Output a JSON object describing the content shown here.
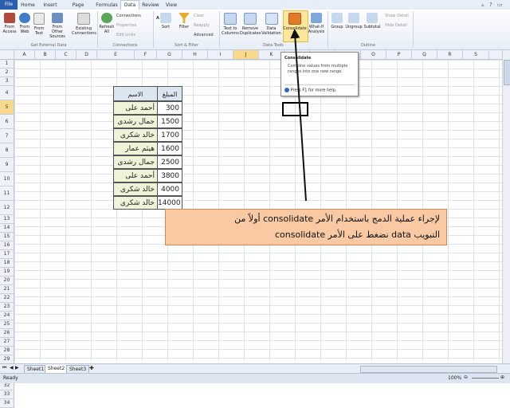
{
  "tabs": [
    "File",
    "Home",
    "Insert",
    "Page Layout",
    "Formulas",
    "Data",
    "Review",
    "View"
  ],
  "active_tab": "Data",
  "ribbon": {
    "get_external": {
      "from_access": "From Access",
      "from_web": "From Web",
      "from_text": "From Text",
      "from_other": "From Other Sources",
      "existing": "Existing Connections",
      "label": "Get External Data"
    },
    "connections": {
      "refresh": "Refresh All",
      "connections": "Connections",
      "properties": "Properties",
      "edit_links": "Edit Links",
      "label": "Connections"
    },
    "sort_filter": {
      "sort_az": "A↓Z",
      "sort": "Sort",
      "filter": "Filter",
      "clear": "Clear",
      "reapply": "Reapply",
      "advanced": "Advanced",
      "label": "Sort & Filter"
    },
    "data_tools": {
      "text_to_columns": "Text to Columns",
      "remove_dup": "Remove Duplicates",
      "validation": "Data Validation",
      "consolidate": "Consolidate",
      "whatif": "What-If Analysis",
      "label": "Data Tools"
    },
    "outline": {
      "group": "Group",
      "ungroup": "Ungroup",
      "subtotal": "Subtotal",
      "show_detail": "Show Detail",
      "hide_detail": "Hide Detail",
      "label": "Outline"
    }
  },
  "columns": [
    "A",
    "B",
    "C",
    "D",
    "E",
    "F",
    "G",
    "H",
    "I",
    "J",
    "K",
    "L",
    "M",
    "N",
    "O",
    "P",
    "Q",
    "R",
    "S"
  ],
  "rows": [
    "1",
    "2",
    "3",
    "4",
    "5",
    "6",
    "7",
    "8",
    "9",
    "10",
    "11",
    "12",
    "13",
    "14",
    "15",
    "16",
    "17",
    "18",
    "19",
    "20",
    "21",
    "22",
    "23",
    "24",
    "25",
    "26",
    "27",
    "28",
    "29",
    "30",
    "31",
    "32",
    "33",
    "34"
  ],
  "table": {
    "header_name": "الاسم",
    "header_amount": "المبلغ",
    "rows": [
      {
        "name": "أحمد على",
        "amount": "300"
      },
      {
        "name": "جمال رشدى",
        "amount": "1500"
      },
      {
        "name": "خالد شكرى",
        "amount": "1700"
      },
      {
        "name": "هيثم عمار",
        "amount": "1600"
      },
      {
        "name": "جمال رشدى",
        "amount": "2500"
      },
      {
        "name": "أحمد على",
        "amount": "3800"
      },
      {
        "name": "خالد شكرى",
        "amount": "4000"
      },
      {
        "name": "خالد شكرى",
        "amount": "14000"
      }
    ]
  },
  "tooltip": {
    "title": "Consolidate",
    "body": "Combine values from multiple ranges into one new range.",
    "help": "Press F1 for more help."
  },
  "note": {
    "line1": "لإجراء عملية الدمج باستخدام الأمر consolidate أولاً من",
    "line2": "التبويب data نضغط على الأمر consolidate"
  },
  "sheets": [
    "Sheet1",
    "Sheet2",
    "Sheet3"
  ],
  "active_sheet": "Sheet2",
  "status": {
    "ready": "Ready",
    "zoom": "100%"
  }
}
